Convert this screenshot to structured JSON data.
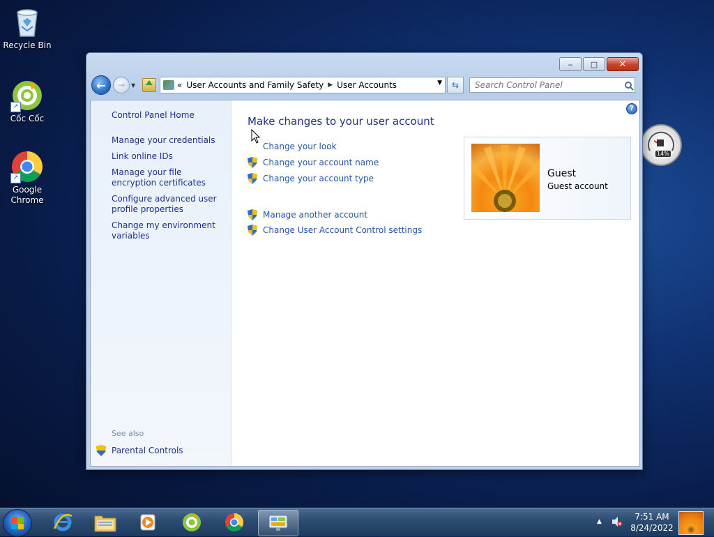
{
  "desktop": {
    "icons": [
      {
        "label": "Recycle Bin"
      },
      {
        "label": "Cốc Cốc"
      },
      {
        "label": "Google Chrome"
      }
    ]
  },
  "window": {
    "controls": {
      "minimize": "‒",
      "maximize": "□",
      "close": "✕"
    },
    "address": {
      "prefix": "«",
      "segments": [
        "User Accounts and Family Safety",
        "User Accounts"
      ]
    },
    "search": {
      "placeholder": "Search Control Panel"
    }
  },
  "left_pane": {
    "home": "Control Panel Home",
    "links": [
      "Manage your credentials",
      "Link online IDs",
      "Manage your file encryption certificates",
      "Configure advanced user profile properties",
      "Change my environment variables"
    ],
    "see_also_label": "See also",
    "see_also_links": [
      "Parental Controls"
    ]
  },
  "main": {
    "heading": "Make changes to your user account",
    "tasks": [
      {
        "label": "Change your look",
        "icon": "none"
      },
      {
        "label": "Change your account name",
        "icon": "shield-icon"
      },
      {
        "label": "Change your account type",
        "icon": "shield-icon"
      }
    ],
    "other_tasks": [
      {
        "label": "Manage another account",
        "icon": "shield-icon"
      },
      {
        "label": "Change User Account Control settings",
        "icon": "shield-icon"
      }
    ],
    "account": {
      "name": "Guest",
      "type": "Guest account"
    }
  },
  "gadget": {
    "cpu_percent": "14%"
  },
  "taskbar": {
    "pinned": [
      "internet-explorer",
      "windows-explorer",
      "media-player",
      "coc-coc",
      "google-chrome",
      "control-panel"
    ],
    "active": "control-panel",
    "clock": {
      "time": "7:51 AM",
      "date": "8/24/2022"
    }
  },
  "colors": {
    "link": "#1e3287",
    "task_link": "#2456a8",
    "taskbar": "#2e4d72"
  }
}
